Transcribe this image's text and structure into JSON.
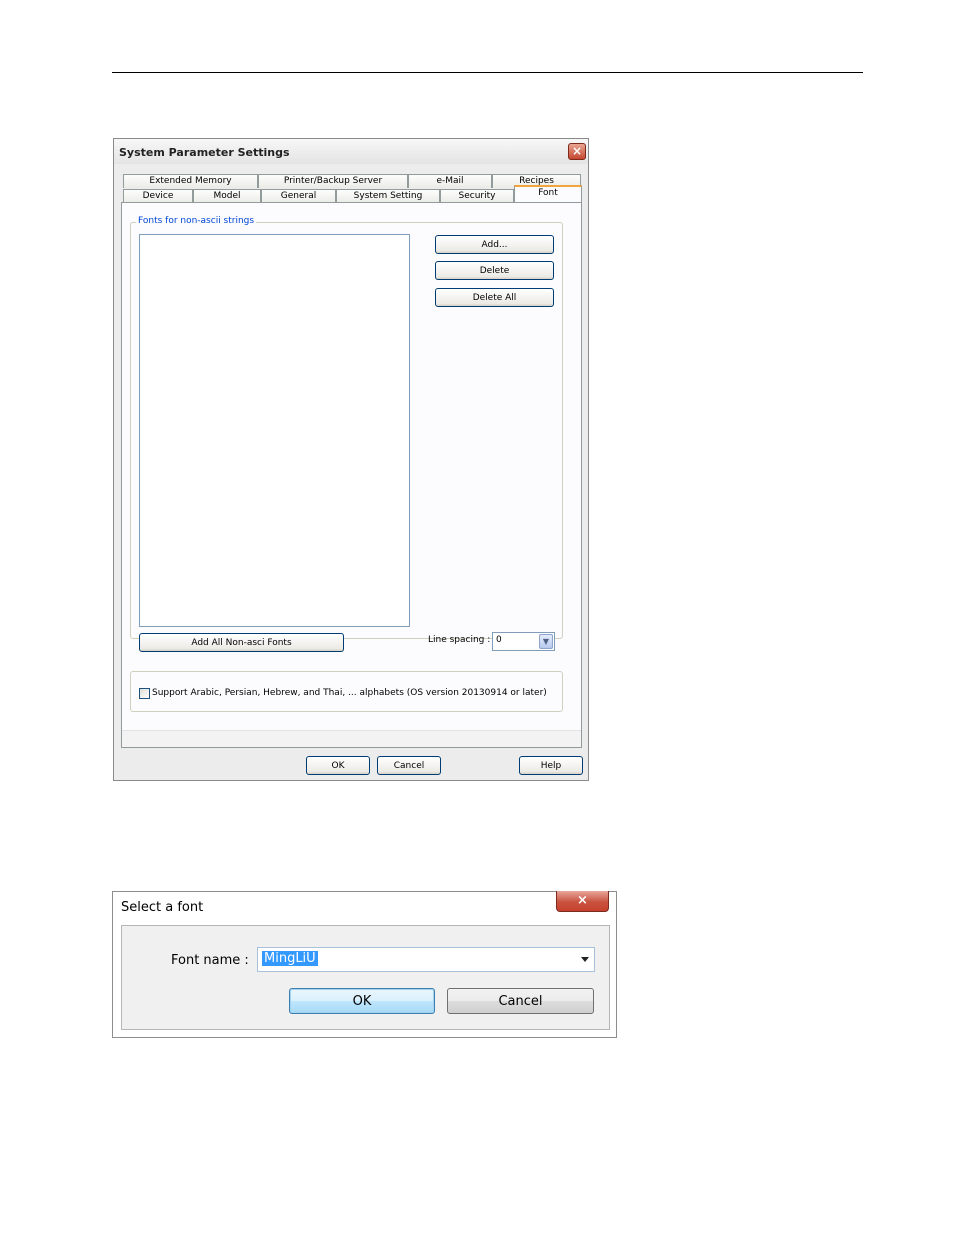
{
  "dialog1": {
    "title": "System Parameter Settings",
    "tabs_back": [
      "Extended Memory",
      "Printer/Backup Server",
      "e-Mail",
      "Recipes"
    ],
    "tabs_front": [
      "Device",
      "Model",
      "General",
      "System Setting",
      "Security",
      "Font"
    ],
    "active_tab": "Font",
    "group_fonts_label": "Fonts for non-ascii strings",
    "btn_add": "Add...",
    "btn_delete": "Delete",
    "btn_delete_all": "Delete All",
    "btn_add_all": "Add All Non-asci Fonts",
    "line_spacing_label": "Line spacing :",
    "line_spacing_value": "0",
    "support_checkbox_label": "Support Arabic, Persian, Hebrew, and Thai, ... alphabets (OS version 20130914 or later)",
    "btn_ok": "OK",
    "btn_cancel": "Cancel",
    "btn_help": "Help"
  },
  "dialog2": {
    "title": "Select a font",
    "font_name_label": "Font name :",
    "font_name_value": "MingLiU",
    "btn_ok": "OK",
    "btn_cancel": "Cancel"
  },
  "icons": {
    "close": "×"
  }
}
